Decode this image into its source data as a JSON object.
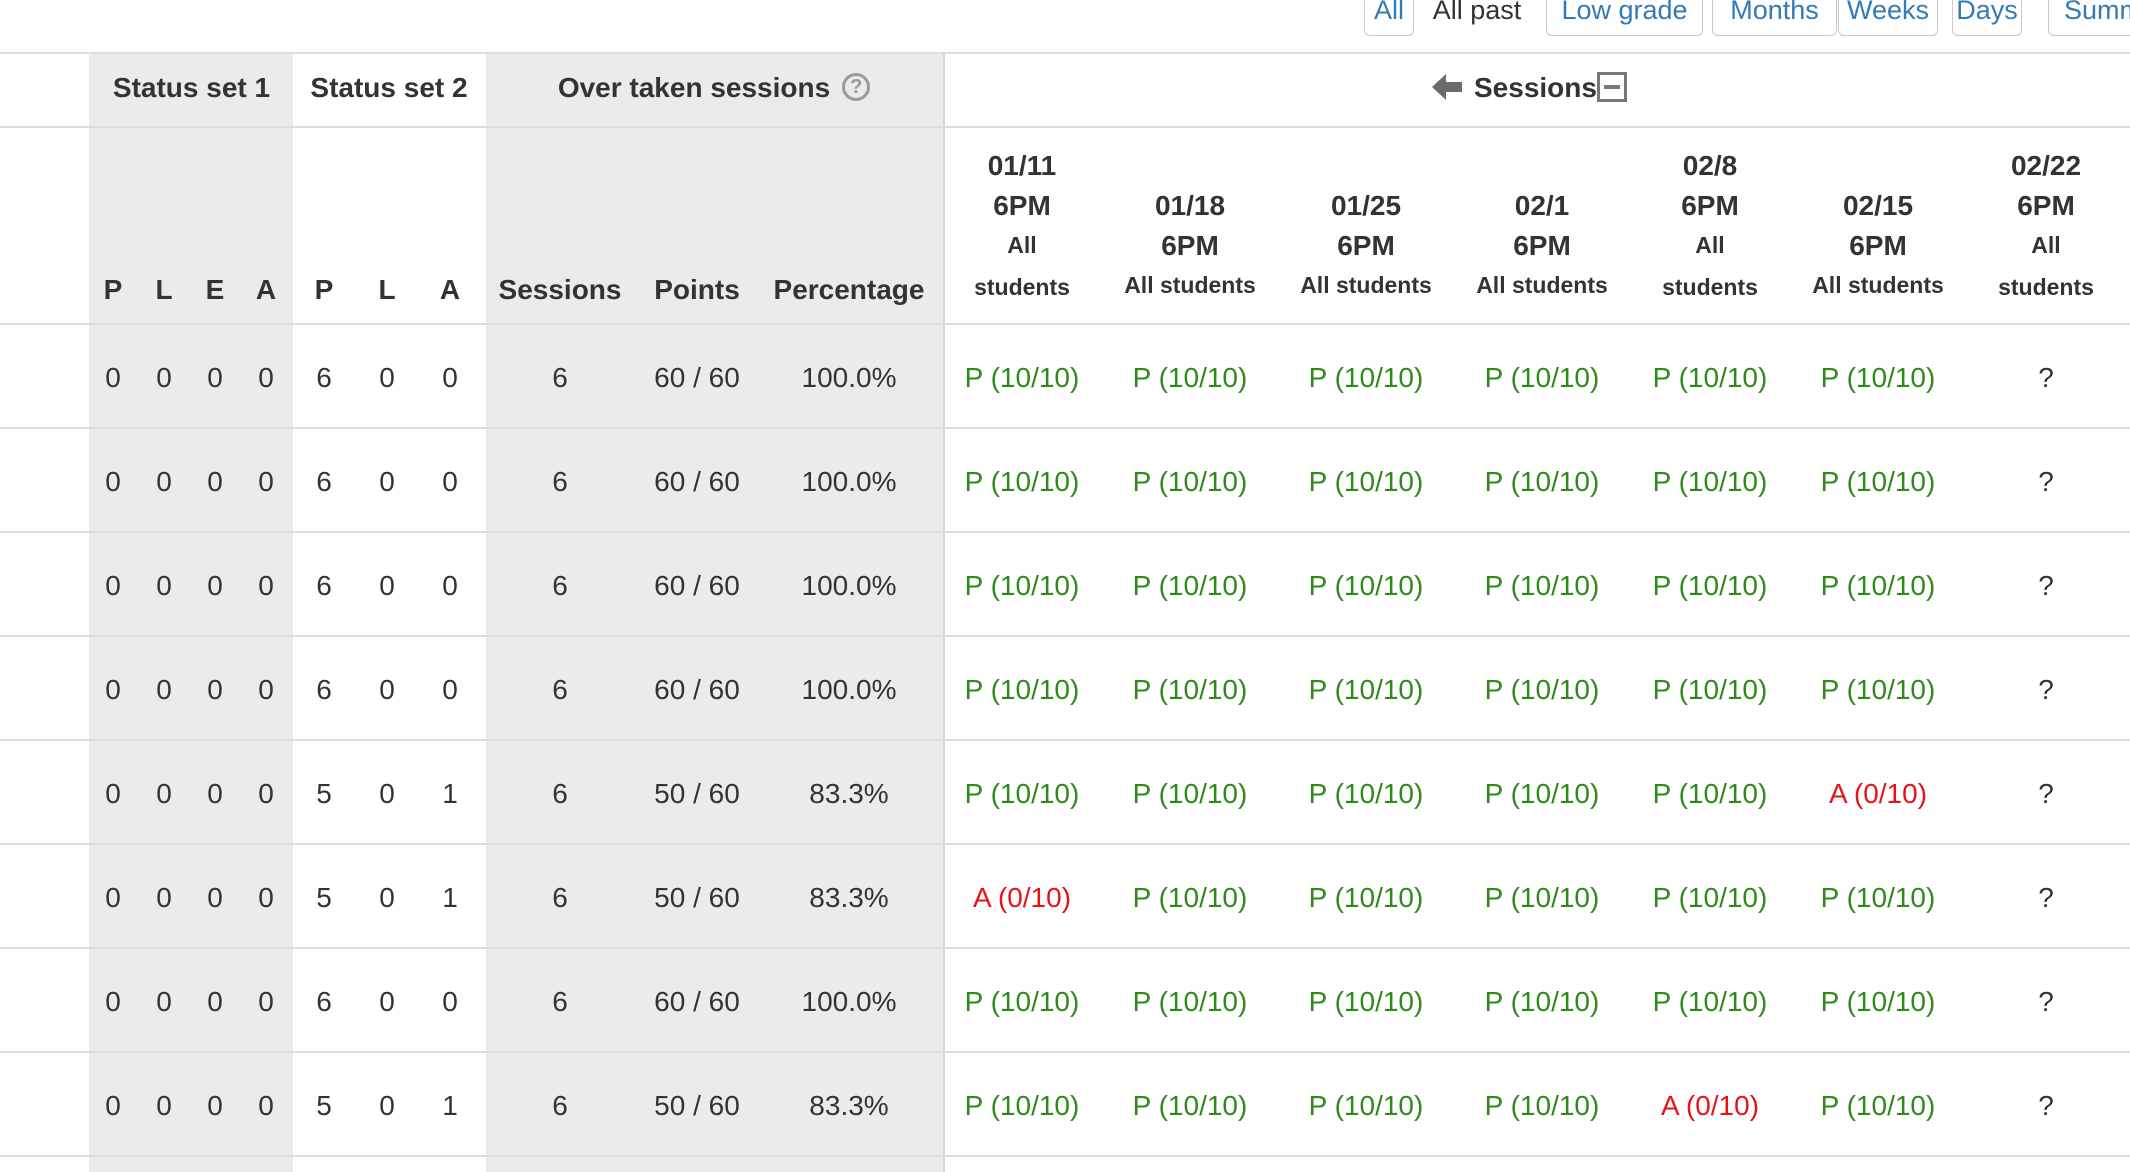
{
  "filters": [
    "All",
    "All past",
    "Low grade",
    "Months",
    "Weeks",
    "Days",
    "Summ"
  ],
  "active_filter": "All past",
  "groups": {
    "status_set_1": "Status set 1",
    "status_set_2": "Status set 2",
    "over_taken": "Over taken sessions",
    "sessions": "Sessions",
    "help_icon": "question-circle-icon",
    "back_icon": "arrow-left-icon",
    "collapse_icon": "minus-square-icon"
  },
  "columns": {
    "set1": [
      "P",
      "L",
      "E",
      "A"
    ],
    "set2": [
      "P",
      "L",
      "A"
    ],
    "totals": [
      "Sessions",
      "Points",
      "Percentage"
    ]
  },
  "sessions": [
    {
      "date": "01/11",
      "time": "6PM",
      "group": [
        "All",
        "students"
      ]
    },
    {
      "date": "01/18",
      "time": "6PM",
      "group": [
        "All students"
      ]
    },
    {
      "date": "01/25",
      "time": "6PM",
      "group": [
        "All students"
      ]
    },
    {
      "date": "02/1",
      "time": "6PM",
      "group": [
        "All students"
      ]
    },
    {
      "date": "02/8",
      "time": "6PM",
      "group": [
        "All",
        "students"
      ]
    },
    {
      "date": "02/15",
      "time": "6PM",
      "group": [
        "All students"
      ]
    },
    {
      "date": "02/22",
      "time": "6PM",
      "group": [
        "All",
        "students"
      ]
    }
  ],
  "rows": [
    {
      "set1": [
        "0",
        "0",
        "0",
        "0"
      ],
      "set2": [
        "6",
        "0",
        "0"
      ],
      "sessions": "6",
      "points": "60 / 60",
      "percentage": "100.0%",
      "cells": [
        "P (10/10)",
        "P (10/10)",
        "P (10/10)",
        "P (10/10)",
        "P (10/10)",
        "P (10/10)",
        "?"
      ]
    },
    {
      "set1": [
        "0",
        "0",
        "0",
        "0"
      ],
      "set2": [
        "6",
        "0",
        "0"
      ],
      "sessions": "6",
      "points": "60 / 60",
      "percentage": "100.0%",
      "cells": [
        "P (10/10)",
        "P (10/10)",
        "P (10/10)",
        "P (10/10)",
        "P (10/10)",
        "P (10/10)",
        "?"
      ]
    },
    {
      "set1": [
        "0",
        "0",
        "0",
        "0"
      ],
      "set2": [
        "6",
        "0",
        "0"
      ],
      "sessions": "6",
      "points": "60 / 60",
      "percentage": "100.0%",
      "cells": [
        "P (10/10)",
        "P (10/10)",
        "P (10/10)",
        "P (10/10)",
        "P (10/10)",
        "P (10/10)",
        "?"
      ]
    },
    {
      "set1": [
        "0",
        "0",
        "0",
        "0"
      ],
      "set2": [
        "6",
        "0",
        "0"
      ],
      "sessions": "6",
      "points": "60 / 60",
      "percentage": "100.0%",
      "cells": [
        "P (10/10)",
        "P (10/10)",
        "P (10/10)",
        "P (10/10)",
        "P (10/10)",
        "P (10/10)",
        "?"
      ]
    },
    {
      "set1": [
        "0",
        "0",
        "0",
        "0"
      ],
      "set2": [
        "5",
        "0",
        "1"
      ],
      "sessions": "6",
      "points": "50 / 60",
      "percentage": "83.3%",
      "cells": [
        "P (10/10)",
        "P (10/10)",
        "P (10/10)",
        "P (10/10)",
        "P (10/10)",
        "A (0/10)",
        "?"
      ]
    },
    {
      "set1": [
        "0",
        "0",
        "0",
        "0"
      ],
      "set2": [
        "5",
        "0",
        "1"
      ],
      "sessions": "6",
      "points": "50 / 60",
      "percentage": "83.3%",
      "cells": [
        "A (0/10)",
        "P (10/10)",
        "P (10/10)",
        "P (10/10)",
        "P (10/10)",
        "P (10/10)",
        "?"
      ]
    },
    {
      "set1": [
        "0",
        "0",
        "0",
        "0"
      ],
      "set2": [
        "6",
        "0",
        "0"
      ],
      "sessions": "6",
      "points": "60 / 60",
      "percentage": "100.0%",
      "cells": [
        "P (10/10)",
        "P (10/10)",
        "P (10/10)",
        "P (10/10)",
        "P (10/10)",
        "P (10/10)",
        "?"
      ]
    },
    {
      "set1": [
        "0",
        "0",
        "0",
        "0"
      ],
      "set2": [
        "5",
        "0",
        "1"
      ],
      "sessions": "6",
      "points": "50 / 60",
      "percentage": "83.3%",
      "cells": [
        "P (10/10)",
        "P (10/10)",
        "P (10/10)",
        "P (10/10)",
        "A (0/10)",
        "P (10/10)",
        "?"
      ]
    }
  ],
  "colors": {
    "present": "#2f8a1b",
    "absent": "#e8121a",
    "link": "#337ab7",
    "band": "#ebebeb"
  }
}
